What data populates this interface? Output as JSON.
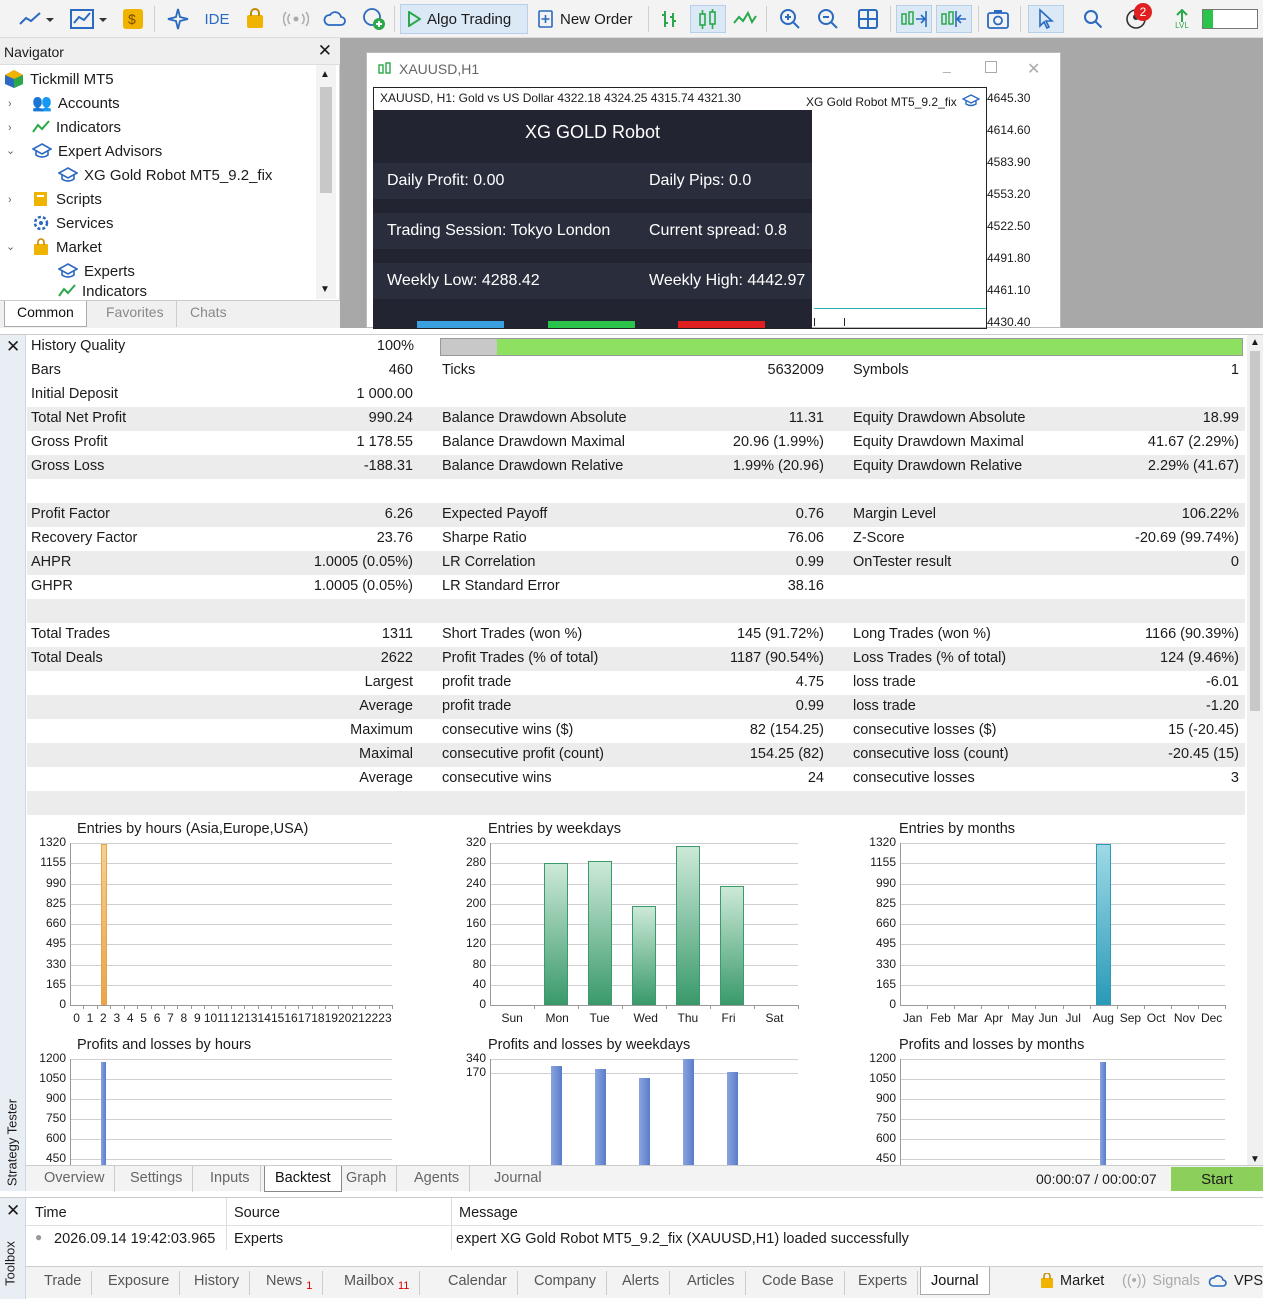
{
  "toolbar": {
    "ide_label": "IDE",
    "algo_trading_label": "Algo Trading",
    "new_order_label": "New Order",
    "notification_count": "2",
    "lvl_label": "LVL"
  },
  "navigator": {
    "title": "Navigator",
    "items": [
      {
        "label": "Tickmill MT5"
      },
      {
        "label": "Accounts"
      },
      {
        "label": "Indicators"
      },
      {
        "label": "Expert Advisors"
      },
      {
        "label": "XG Gold Robot MT5_9.2_fix"
      },
      {
        "label": "Scripts"
      },
      {
        "label": "Services"
      },
      {
        "label": "Market"
      },
      {
        "label": "Experts"
      },
      {
        "label": "Indicators"
      }
    ],
    "tabs": [
      "Common",
      "Favorites",
      "Chats"
    ]
  },
  "chart": {
    "window_title": "XAUUSD,H1",
    "header_info": "XAUUSD, H1:  Gold vs US Dollar   4322.18 4324.25 4315.74 4321.30",
    "ea_label": "XG Gold Robot MT5_9.2_fix",
    "price_labels": [
      "4645.30",
      "4614.60",
      "4583.90",
      "4553.20",
      "4522.50",
      "4491.80",
      "4461.10",
      "4430.40"
    ],
    "panel": {
      "title": "XG GOLD Robot",
      "daily_profit": "Daily Profit: 0.00",
      "daily_pips": "Daily Pips:   0.0",
      "session": "Trading Session: Tokyo London",
      "spread": "Current spread: 0.8",
      "weekly_low": "Weekly Low: 4288.42",
      "weekly_high": "Weekly High: 4442.97"
    }
  },
  "history_quality": {
    "label": "History Quality",
    "value": "100%",
    "fraction": 0.93
  },
  "stats": [
    [
      [
        "Bars",
        "460"
      ],
      [
        "Ticks",
        "5632009"
      ],
      [
        "Symbols",
        "1"
      ]
    ],
    [
      [
        "Initial Deposit",
        "1 000.00"
      ],
      [
        "",
        ""
      ],
      [
        "",
        ""
      ]
    ],
    [
      [
        "Total Net Profit",
        "990.24"
      ],
      [
        "Balance Drawdown Absolute",
        "11.31"
      ],
      [
        "Equity Drawdown Absolute",
        "18.99"
      ]
    ],
    [
      [
        "Gross Profit",
        "1 178.55"
      ],
      [
        "Balance Drawdown Maximal",
        "20.96 (1.99%)"
      ],
      [
        "Equity Drawdown Maximal",
        "41.67 (2.29%)"
      ]
    ],
    [
      [
        "Gross Loss",
        "-188.31"
      ],
      [
        "Balance Drawdown Relative",
        "1.99% (20.96)"
      ],
      [
        "Equity Drawdown Relative",
        "2.29% (41.67)"
      ]
    ],
    [
      [
        "",
        ""
      ],
      [
        "",
        ""
      ],
      [
        "",
        ""
      ]
    ],
    [
      [
        "Profit Factor",
        "6.26"
      ],
      [
        "Expected Payoff",
        "0.76"
      ],
      [
        "Margin Level",
        "106.22%"
      ]
    ],
    [
      [
        "Recovery Factor",
        "23.76"
      ],
      [
        "Sharpe Ratio",
        "76.06"
      ],
      [
        "Z-Score",
        "-20.69 (99.74%)"
      ]
    ],
    [
      [
        "AHPR",
        "1.0005 (0.05%)"
      ],
      [
        "LR Correlation",
        "0.99"
      ],
      [
        "OnTester result",
        "0"
      ]
    ],
    [
      [
        "GHPR",
        "1.0005 (0.05%)"
      ],
      [
        "LR Standard Error",
        "38.16"
      ],
      [
        "",
        ""
      ]
    ],
    [
      [
        "",
        ""
      ],
      [
        "",
        ""
      ],
      [
        "",
        ""
      ]
    ],
    [
      [
        "Total Trades",
        "1311"
      ],
      [
        "Short Trades (won %)",
        "145 (91.72%)"
      ],
      [
        "Long Trades (won %)",
        "1166 (90.39%)"
      ]
    ],
    [
      [
        "Total Deals",
        "2622"
      ],
      [
        "Profit Trades (% of total)",
        "1187 (90.54%)"
      ],
      [
        "Loss Trades (% of total)",
        "124 (9.46%)"
      ]
    ]
  ],
  "stats2": [
    {
      "label": "Largest",
      "a": "profit trade",
      "av": "4.75",
      "b": "loss trade",
      "bv": "-6.01"
    },
    {
      "label": "Average",
      "a": "profit trade",
      "av": "0.99",
      "b": "loss trade",
      "bv": "-1.20"
    },
    {
      "label": "Maximum",
      "a": "consecutive wins ($)",
      "av": "82 (154.25)",
      "b": "consecutive losses ($)",
      "bv": "15 (-20.45)"
    },
    {
      "label": "Maximal",
      "a": "consecutive profit (count)",
      "av": "154.25 (82)",
      "b": "consecutive loss (count)",
      "bv": "-20.45 (15)"
    },
    {
      "label": "Average",
      "a": "consecutive wins",
      "av": "24",
      "b": "consecutive losses",
      "bv": "3"
    }
  ],
  "chart_data": [
    {
      "type": "bar",
      "title": "Entries by hours (Asia,Europe,USA)",
      "categories": [
        "0",
        "1",
        "2",
        "3",
        "4",
        "5",
        "6",
        "7",
        "8",
        "9",
        "10",
        "11",
        "12",
        "13",
        "14",
        "15",
        "16",
        "17",
        "18",
        "19",
        "20",
        "21",
        "22",
        "23"
      ],
      "values": [
        0,
        0,
        1311,
        0,
        0,
        0,
        0,
        0,
        0,
        0,
        0,
        0,
        0,
        0,
        0,
        0,
        0,
        0,
        0,
        0,
        0,
        0,
        0,
        0
      ],
      "yticks": [
        "1320",
        "1155",
        "990",
        "825",
        "660",
        "495",
        "330",
        "165",
        "0"
      ],
      "ylim": [
        0,
        1320
      ],
      "color": "#e8a44a"
    },
    {
      "type": "bar",
      "title": "Entries by weekdays",
      "categories": [
        "Sun",
        "Mon",
        "Tue",
        "Wed",
        "Thu",
        "Fri",
        "Sat"
      ],
      "values": [
        0,
        280,
        285,
        195,
        315,
        236,
        0
      ],
      "yticks": [
        "320",
        "280",
        "240",
        "200",
        "160",
        "120",
        "80",
        "40",
        "0"
      ],
      "ylim": [
        0,
        320
      ],
      "color": "#3a9a6c"
    },
    {
      "type": "bar",
      "title": "Entries by months",
      "categories": [
        "Jan",
        "Feb",
        "Mar",
        "Apr",
        "May",
        "Jun",
        "Jul",
        "Aug",
        "Sep",
        "Oct",
        "Nov",
        "Dec"
      ],
      "values": [
        0,
        0,
        0,
        0,
        0,
        0,
        0,
        1311,
        0,
        0,
        0,
        0
      ],
      "yticks": [
        "1320",
        "1155",
        "990",
        "825",
        "660",
        "495",
        "330",
        "165",
        "0"
      ],
      "ylim": [
        0,
        1320
      ],
      "color": "#2a9ab8"
    },
    {
      "type": "bar",
      "title": "Profits and losses by hours",
      "values_note": "",
      "yticks": [
        "1200",
        "1050",
        "900",
        "750",
        "600",
        "450"
      ],
      "ylim": [
        450,
        1200
      ],
      "bars": [
        {
          "x": 2,
          "value": 1178
        }
      ],
      "color": "#5a7cc8"
    },
    {
      "type": "bar",
      "title": "Profits and losses by weekdays",
      "yticks": [
        "340",
        "170"
      ],
      "ylim": [
        100,
        340
      ],
      "bars": [
        {
          "x": 1,
          "value": 255
        },
        {
          "x": 2,
          "value": 215
        },
        {
          "x": 3,
          "value": 110
        },
        {
          "x": 4,
          "value": 340
        },
        {
          "x": 5,
          "value": 188
        }
      ],
      "color": "#5a7cc8"
    },
    {
      "type": "bar",
      "title": "Profits and losses by months",
      "yticks": [
        "1200",
        "1050",
        "900",
        "750",
        "600",
        "450"
      ],
      "ylim": [
        450,
        1200
      ],
      "bars": [
        {
          "x": 7,
          "value": 1178
        }
      ],
      "color": "#5a7cc8"
    }
  ],
  "tester": {
    "side_label": "Strategy Tester",
    "tabs": [
      "Overview",
      "Settings",
      "Inputs",
      "Backtest",
      "Graph",
      "Agents",
      "Journal"
    ],
    "timer": "00:00:07 / 00:00:07",
    "start_label": "Start"
  },
  "toolbox": {
    "side_label": "Toolbox",
    "columns": [
      "Time",
      "Source",
      "Message"
    ],
    "row": {
      "time": "2026.09.14 19:42:03.965",
      "source": "Experts",
      "message": "expert XG Gold Robot MT5_9.2_fix (XAUUSD,H1) loaded successfully"
    },
    "tabs": [
      "Trade",
      "Exposure",
      "History",
      "News",
      "Mailbox",
      "Calendar",
      "Company",
      "Alerts",
      "Articles",
      "Code Base",
      "Experts",
      "Journal"
    ],
    "news_count": "1",
    "mailbox_count": "11",
    "market_label": "Market",
    "signals_label": "Signals",
    "vps_label": "VPS"
  }
}
